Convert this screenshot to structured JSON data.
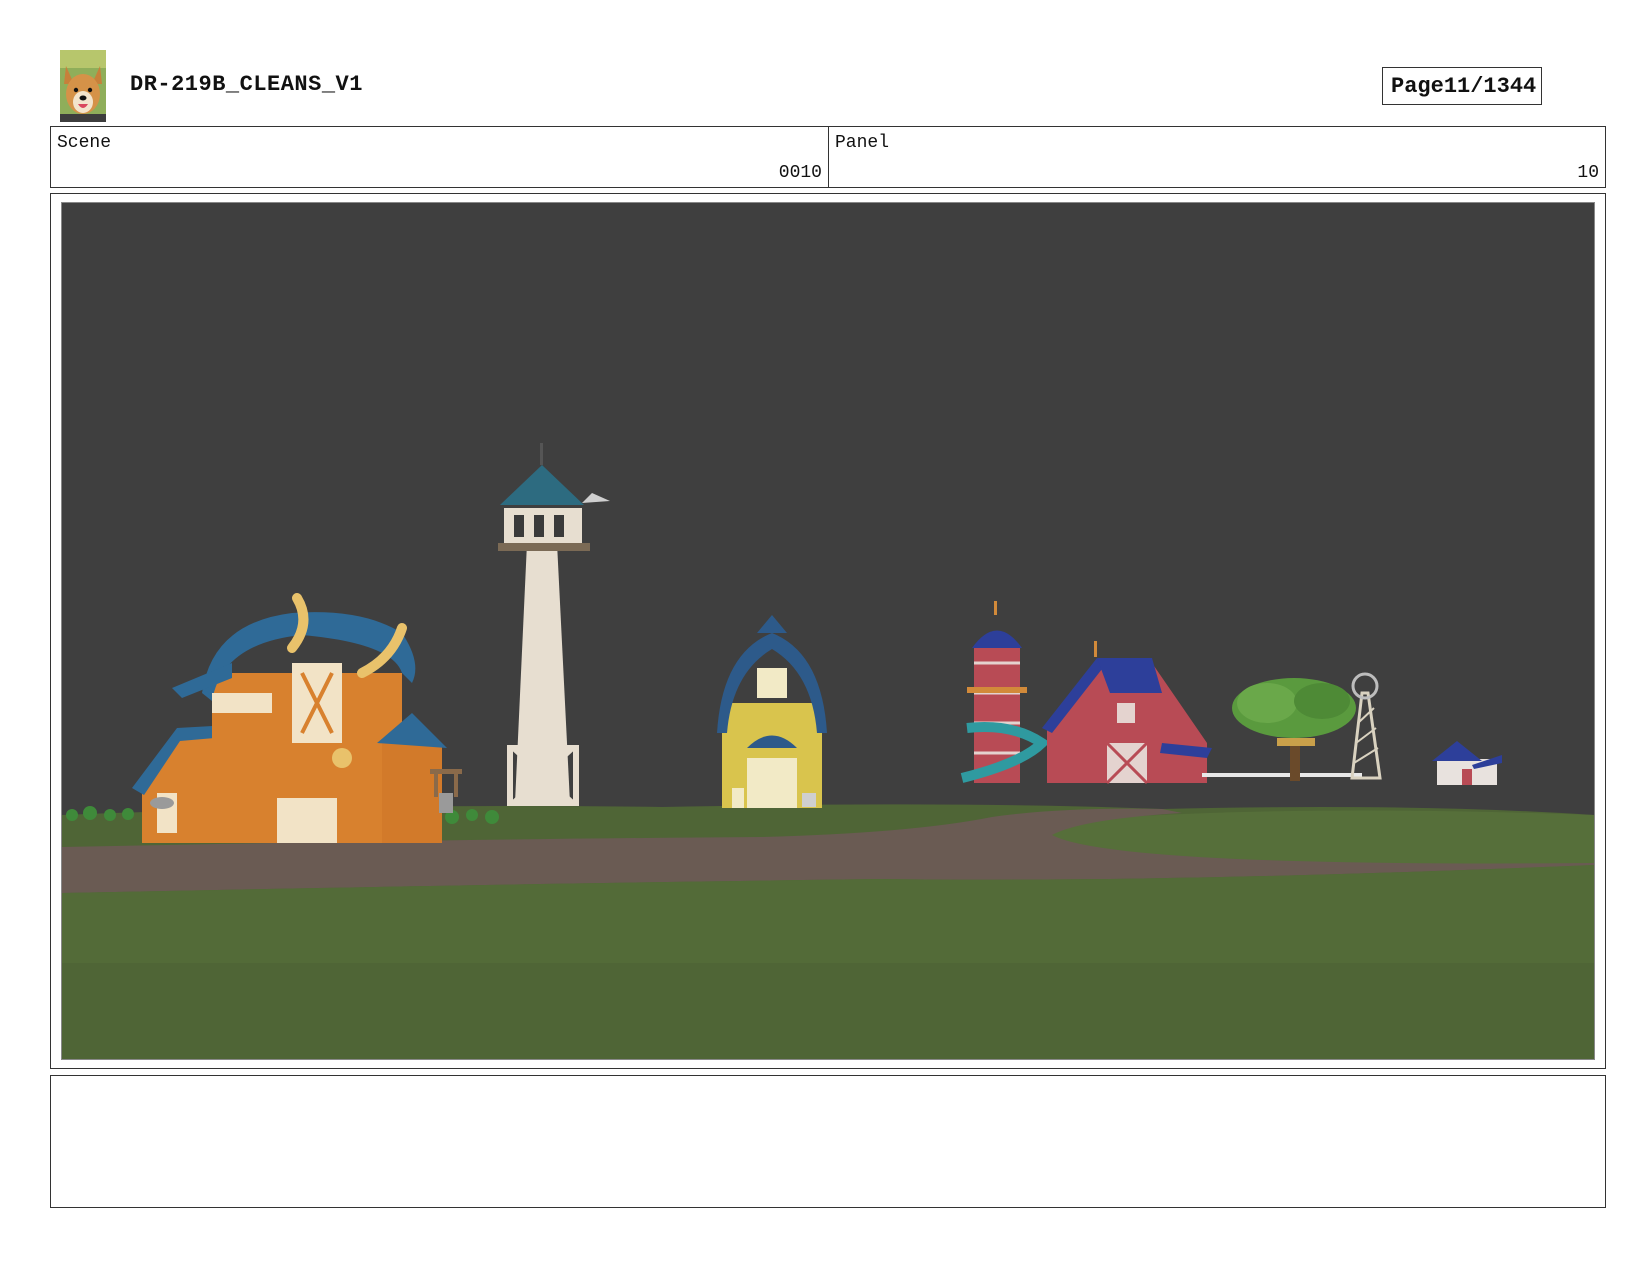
{
  "header": {
    "title": "DR-219B_CLEANS_V1",
    "page_label": "Page",
    "page_value": "11/1344",
    "logo_icon": "dog-avatar-icon"
  },
  "info": {
    "scene_label": "Scene",
    "scene_value": "0010",
    "panel_label": "Panel",
    "panel_value": "10"
  },
  "frame": {
    "illustration": "farm-scene-render",
    "colors": {
      "sky": "#3f3f3f",
      "grass": "#536b38",
      "path": "#6a5b53",
      "orange_barn": "#d8812e",
      "yellow_house": "#d9c44d",
      "red_barn": "#b84b55",
      "blue_roof": "#2d5a8a"
    }
  },
  "notes": {
    "text": ""
  }
}
